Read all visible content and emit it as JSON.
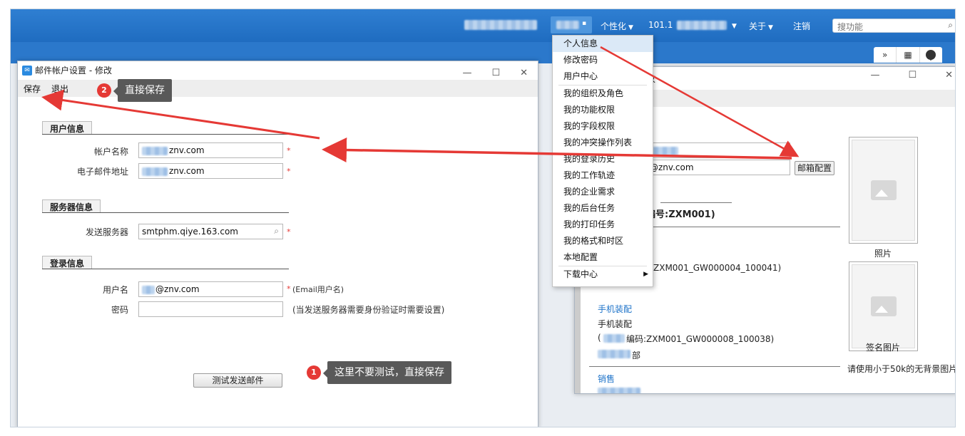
{
  "topbar": {
    "personalize": "个性化",
    "version": "101.1",
    "about": "关于",
    "logout": "注销",
    "search_placeholder": "搜功能"
  },
  "menu": {
    "items": [
      "个人信息",
      "修改密码",
      "用户中心",
      "我的组织及角色",
      "我的功能权限",
      "我的字段权限",
      "我的冲突操作列表",
      "我的登录历史",
      "我的工作轨迹",
      "我的企业需求",
      "我的后台任务",
      "我的打印任务",
      "我的格式和时区",
      "本地配置"
    ],
    "download": "下载中心"
  },
  "left_dialog": {
    "title": "邮件帐户设置 - 修改",
    "menu_save": "保存",
    "menu_exit": "退出",
    "section_user": "用户信息",
    "label_account": "帐户名称",
    "value_account": "znv.com",
    "label_email": "电子邮件地址",
    "value_email": "znv.com",
    "section_server": "服务器信息",
    "label_server": "发送服务器",
    "value_server": "smtphm.qiye.163.com",
    "section_login": "登录信息",
    "label_user": "用户名",
    "value_user": "@znv.com",
    "hint_user": "(Email用户名)",
    "label_password": "密码",
    "hint_password": "(当发送服务器需要身份验证时需要设置)",
    "test_button": "测试发送邮件"
  },
  "right_dialog": {
    "title_fragment": "改",
    "email_fragment": "@znv.com",
    "mail_config_button": "邮箱配置",
    "code_text": "编号:ZXM001)",
    "position1": "ZXM001_GW000004_100041)",
    "link_mobile": "手机装配",
    "mobile_text": "手机装配",
    "position2": "(",
    "position2_code": "编码:ZXM001_GW000008_100038)",
    "dept_suffix": "部",
    "link_sales": "销售",
    "photo_label": "照片",
    "sign_label": "签名图片",
    "photo_hint": "请使用小于50k的无背景图片"
  },
  "callouts": {
    "c1_badge": "1",
    "c1_text": "这里不要测试，直接保存",
    "c2_badge": "2",
    "c2_text": "直接保存"
  },
  "colors": {
    "topbar": "#2f7fd2",
    "arrow": "#e53935",
    "callout": "#595959",
    "menu_active": "#dbe9f7"
  }
}
